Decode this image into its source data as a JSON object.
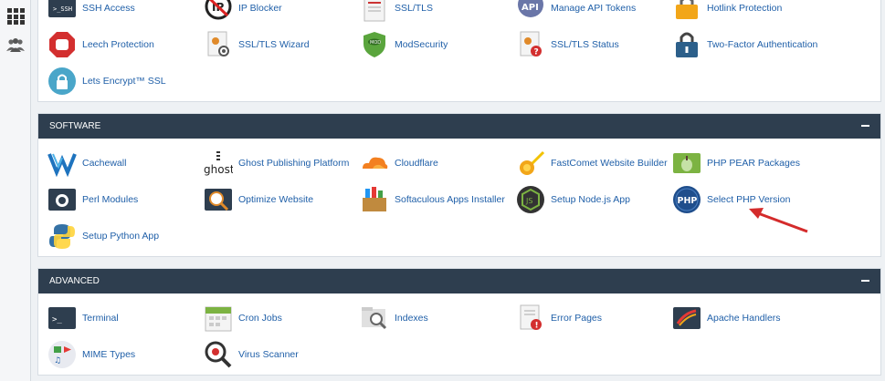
{
  "security": {
    "items": [
      {
        "label": "SSH Access",
        "icon": "ssh-terminal-icon"
      },
      {
        "label": "IP Blocker",
        "icon": "ip-blocker-icon"
      },
      {
        "label": "SSL/TLS",
        "icon": "ssl-certificate-icon"
      },
      {
        "label": "Manage API Tokens",
        "icon": "api-icon"
      },
      {
        "label": "Hotlink Protection",
        "icon": "hotlink-lock-icon"
      },
      {
        "label": "Leech Protection",
        "icon": "stop-sign-icon"
      },
      {
        "label": "SSL/TLS Wizard",
        "icon": "ssl-wizard-icon"
      },
      {
        "label": "ModSecurity",
        "icon": "modsecurity-shield-icon"
      },
      {
        "label": "SSL/TLS Status",
        "icon": "ssl-status-icon"
      },
      {
        "label": "Two-Factor Authentication",
        "icon": "padlock-icon"
      },
      {
        "label": "Lets Encrypt™ SSL",
        "icon": "lets-encrypt-icon"
      }
    ]
  },
  "software": {
    "title": "SOFTWARE",
    "items": [
      {
        "label": "Cachewall",
        "icon": "cachewall-icon"
      },
      {
        "label": "Ghost Publishing Platform",
        "icon": "ghost-icon",
        "logo_text": "ghost"
      },
      {
        "label": "Cloudflare",
        "icon": "cloudflare-icon"
      },
      {
        "label": "FastComet Website Builder",
        "icon": "rocket-icon"
      },
      {
        "label": "PHP PEAR Packages",
        "icon": "php-pear-icon"
      },
      {
        "label": "Perl Modules",
        "icon": "perl-icon"
      },
      {
        "label": "Optimize Website",
        "icon": "optimize-icon"
      },
      {
        "label": "Softaculous Apps Installer",
        "icon": "softaculous-icon"
      },
      {
        "label": "Setup Node.js App",
        "icon": "nodejs-icon"
      },
      {
        "label": "Select PHP Version",
        "icon": "php-icon",
        "logo_text": "PHP"
      },
      {
        "label": "Setup Python App",
        "icon": "python-icon"
      }
    ]
  },
  "advanced": {
    "title": "ADVANCED",
    "items": [
      {
        "label": "Terminal",
        "icon": "terminal-icon"
      },
      {
        "label": "Cron Jobs",
        "icon": "cron-calendar-icon"
      },
      {
        "label": "Indexes",
        "icon": "indexes-icon"
      },
      {
        "label": "Error Pages",
        "icon": "error-pages-icon"
      },
      {
        "label": "Apache Handlers",
        "icon": "apache-icon"
      },
      {
        "label": "MIME Types",
        "icon": "mime-icon"
      },
      {
        "label": "Virus Scanner",
        "icon": "virus-scanner-icon"
      }
    ]
  },
  "sidebar": {
    "icons": [
      "apps-grid-icon",
      "users-icon"
    ]
  },
  "colors": {
    "header_bg": "#2e3e4f",
    "link": "#1f5fa8",
    "arrow": "#d42b2b",
    "page_bg": "#eef1f4"
  }
}
